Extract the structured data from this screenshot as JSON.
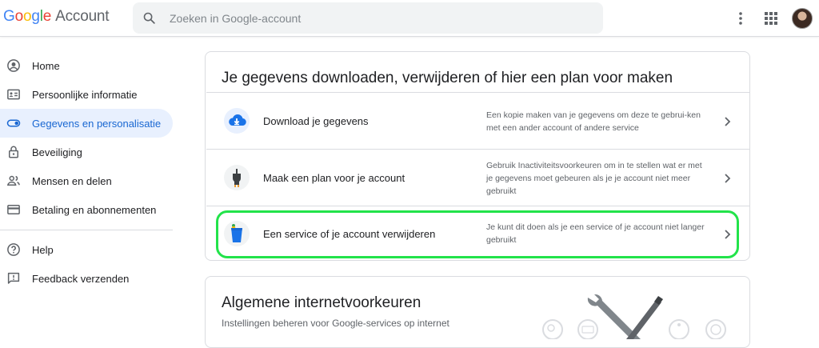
{
  "header": {
    "logo_google": [
      "G",
      "o",
      "o",
      "g",
      "l",
      "e"
    ],
    "logo_account": "Account",
    "search_placeholder": "Zoeken in Google-account"
  },
  "sidebar": {
    "items": [
      {
        "label": "Home",
        "icon": "account-circle-icon"
      },
      {
        "label": "Persoonlijke informatie",
        "icon": "id-card-icon"
      },
      {
        "label": "Gegevens en personalisatie",
        "icon": "toggle-icon",
        "active": true
      },
      {
        "label": "Beveiliging",
        "icon": "lock-icon"
      },
      {
        "label": "Mensen en delen",
        "icon": "people-icon"
      },
      {
        "label": "Betaling en abonnementen",
        "icon": "credit-card-icon"
      }
    ],
    "footer_items": [
      {
        "label": "Help",
        "icon": "help-icon"
      },
      {
        "label": "Feedback verzenden",
        "icon": "feedback-icon"
      }
    ]
  },
  "data_card": {
    "title": "Je gegevens downloaden, verwijderen of hier een plan voor maken",
    "rows": [
      {
        "label": "Download je gegevens",
        "desc": "Een kopie maken van je gegevens om deze te gebrui-ken met een ander account of andere service",
        "icon": "cloud-download-icon"
      },
      {
        "label": "Maak een plan voor je account",
        "desc": "Gebruik Inactiviteitsvoorkeuren om in te stellen wat er met je gegevens moet gebeuren als je je account niet meer gebruikt",
        "icon": "plug-icon"
      },
      {
        "label": "Een service of je account verwijderen",
        "desc": "Je kunt dit doen als je een service of je account niet langer gebruikt",
        "icon": "trash-icon"
      }
    ]
  },
  "prefs_card": {
    "title": "Algemene internetvoorkeuren",
    "subtitle": "Instellingen beheren voor Google-services op internet"
  },
  "colors": {
    "active_bg": "#e8f0fe",
    "active_text": "#1967d2",
    "highlight": "#22e34a"
  }
}
